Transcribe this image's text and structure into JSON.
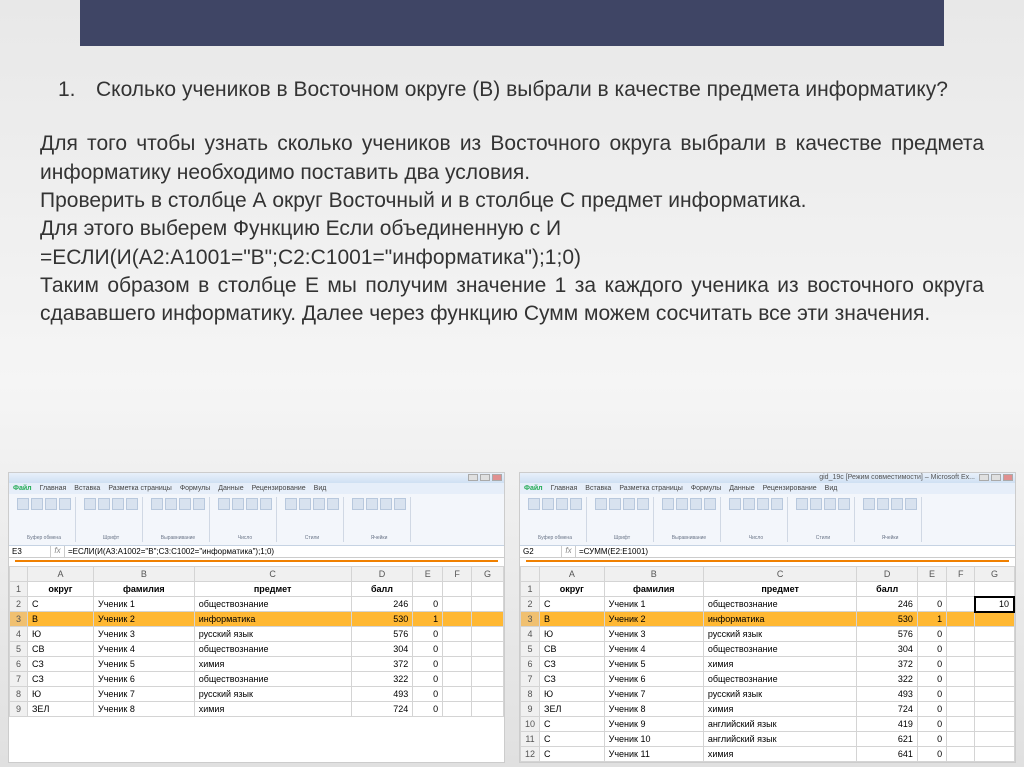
{
  "question": {
    "number": "1.",
    "text": "Сколько учеников в Восточном округе (В) выбрали в качестве предмета информатику?"
  },
  "explanation": {
    "p1": "Для того чтобы узнать сколько учеников из Восточного округа выбрали в качестве предмета информатику необходимо поставить два условия.",
    "p2": "Проверить в столбце А округ Восточный и в столбце С предмет информатика.",
    "p3": "Для этого выберем Функцию Если  объединенную с И",
    "p4": "=ЕСЛИ(И(A2:A1001=\"В\";C2:C1001=\"информатика\");1;0)",
    "p5": "Таким образом в столбце Е мы получим значение 1 за каждого ученика из восточного округа сдававшего информатику. Далее через функцию Сумм можем сосчитать все эти значения."
  },
  "ribbon_tabs": [
    "Файл",
    "Главная",
    "Вставка",
    "Разметка страницы",
    "Формулы",
    "Данные",
    "Рецензирование",
    "Вид"
  ],
  "ribbon_groups": [
    "Буфер обмена",
    "Шрифт",
    "Выравнивание",
    "Число",
    "Стили",
    "Ячейки"
  ],
  "font_name": "Times New Roman",
  "font_size": "14",
  "left_excel": {
    "name_box": "E3",
    "formula": "=ЕСЛИ(И(A3:A1002=\"В\";C3:C1002=\"информатика\");1;0)",
    "columns": [
      "",
      "A",
      "B",
      "C",
      "D",
      "E",
      "F",
      "G"
    ],
    "headers_row": [
      "1",
      "округ",
      "фамилия",
      "предмет",
      "балл",
      "",
      "",
      ""
    ],
    "rows": [
      [
        "2",
        "С",
        "Ученик 1",
        "обществознание",
        "246",
        "0",
        "",
        ""
      ],
      [
        "3",
        "В",
        "Ученик 2",
        "информатика",
        "530",
        "1",
        "",
        ""
      ],
      [
        "4",
        "Ю",
        "Ученик 3",
        "русский язык",
        "576",
        "0",
        "",
        ""
      ],
      [
        "5",
        "СВ",
        "Ученик 4",
        "обществознание",
        "304",
        "0",
        "",
        ""
      ],
      [
        "6",
        "СЗ",
        "Ученик 5",
        "химия",
        "372",
        "0",
        "",
        ""
      ],
      [
        "7",
        "СЗ",
        "Ученик 6",
        "обществознание",
        "322",
        "0",
        "",
        ""
      ],
      [
        "8",
        "Ю",
        "Ученик 7",
        "русский язык",
        "493",
        "0",
        "",
        ""
      ],
      [
        "9",
        "ЗЕЛ",
        "Ученик 8",
        "химия",
        "724",
        "0",
        "",
        ""
      ]
    ],
    "highlight_row_index": 1
  },
  "right_excel": {
    "title_suffix": "gid_19c [Режим совместимости] – Microsoft Ex...",
    "name_box": "G2",
    "formula": "=СУММ(E2:E1001)",
    "columns": [
      "",
      "A",
      "B",
      "C",
      "D",
      "E",
      "F",
      "G"
    ],
    "headers_row": [
      "1",
      "округ",
      "фамилия",
      "предмет",
      "балл",
      "",
      "",
      ""
    ],
    "rows": [
      [
        "2",
        "С",
        "Ученик 1",
        "обществознание",
        "246",
        "0",
        "",
        "10"
      ],
      [
        "3",
        "В",
        "Ученик 2",
        "информатика",
        "530",
        "1",
        "",
        ""
      ],
      [
        "4",
        "Ю",
        "Ученик 3",
        "русский язык",
        "576",
        "0",
        "",
        ""
      ],
      [
        "5",
        "СВ",
        "Ученик 4",
        "обществознание",
        "304",
        "0",
        "",
        ""
      ],
      [
        "6",
        "СЗ",
        "Ученик 5",
        "химия",
        "372",
        "0",
        "",
        ""
      ],
      [
        "7",
        "СЗ",
        "Ученик 6",
        "обществознание",
        "322",
        "0",
        "",
        ""
      ],
      [
        "8",
        "Ю",
        "Ученик 7",
        "русский язык",
        "493",
        "0",
        "",
        ""
      ],
      [
        "9",
        "ЗЕЛ",
        "Ученик 8",
        "химия",
        "724",
        "0",
        "",
        ""
      ],
      [
        "10",
        "С",
        "Ученик 9",
        "английский язык",
        "419",
        "0",
        "",
        ""
      ],
      [
        "11",
        "С",
        "Ученик 10",
        "английский язык",
        "621",
        "0",
        "",
        ""
      ],
      [
        "12",
        "С",
        "Ученик 11",
        "химия",
        "641",
        "0",
        "",
        ""
      ]
    ],
    "highlight_row_index": 1,
    "selected_cell": {
      "row": 0,
      "col": 7
    }
  }
}
